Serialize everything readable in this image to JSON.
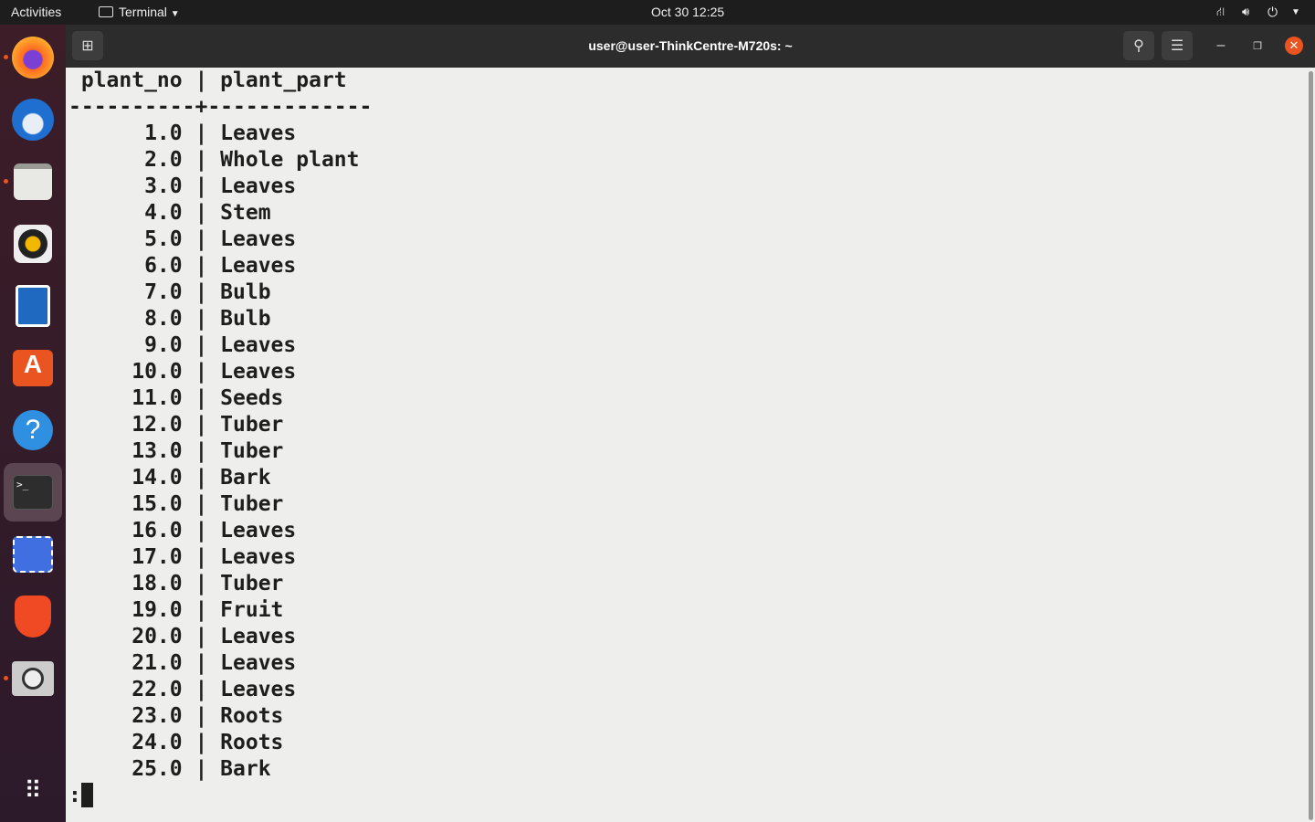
{
  "topbar": {
    "activities": "Activities",
    "app_menu": "Terminal",
    "clock": "Oct 30  12:25"
  },
  "window": {
    "title": "user@user-ThinkCentre-M720s: ~"
  },
  "dock": [
    "firefox",
    "thunderbird",
    "files",
    "rhythmbox",
    "libreoffice-writer",
    "ubuntu-software",
    "help",
    "terminal",
    "screenshot",
    "brave",
    "image-viewer",
    "show-applications"
  ],
  "terminal": {
    "headers": [
      "plant_no",
      "plant_part"
    ],
    "rows": [
      [
        "1.0",
        "Leaves"
      ],
      [
        "2.0",
        "Whole plant"
      ],
      [
        "3.0",
        "Leaves"
      ],
      [
        "4.0",
        "Stem"
      ],
      [
        "5.0",
        "Leaves"
      ],
      [
        "6.0",
        "Leaves"
      ],
      [
        "7.0",
        "Bulb"
      ],
      [
        "8.0",
        "Bulb"
      ],
      [
        "9.0",
        "Leaves"
      ],
      [
        "10.0",
        "Leaves"
      ],
      [
        "11.0",
        "Seeds"
      ],
      [
        "12.0",
        "Tuber"
      ],
      [
        "13.0",
        "Tuber"
      ],
      [
        "14.0",
        "Bark"
      ],
      [
        "15.0",
        "Tuber"
      ],
      [
        "16.0",
        "Leaves"
      ],
      [
        "17.0",
        "Leaves"
      ],
      [
        "18.0",
        "Tuber"
      ],
      [
        "19.0",
        "Fruit"
      ],
      [
        "20.0",
        "Leaves"
      ],
      [
        "21.0",
        "Leaves"
      ],
      [
        "22.0",
        "Leaves"
      ],
      [
        "23.0",
        "Roots"
      ],
      [
        "24.0",
        "Roots"
      ],
      [
        "25.0",
        "Bark"
      ]
    ],
    "prompt": ":"
  }
}
